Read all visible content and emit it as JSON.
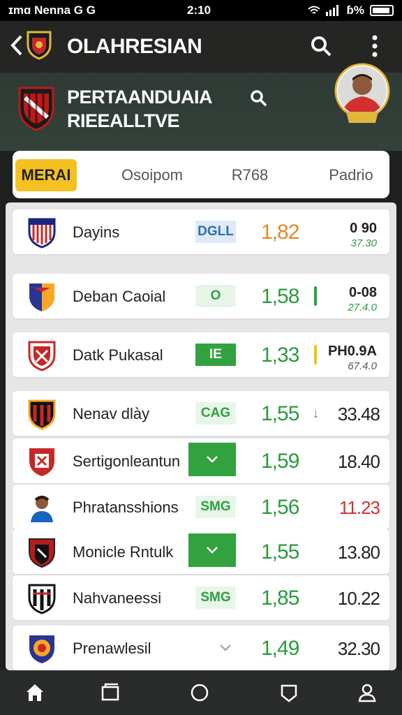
{
  "status_bar": {
    "left": "ɪmɑ Nenna  G  G",
    "time": "2:10",
    "right": "Ꞩ% ",
    "battery_label": "ɓ%"
  },
  "app_bar": {
    "title": "OLAHRESIAN",
    "back_icon": "chevron-left-icon",
    "search_icon": "search-icon",
    "menu_icon": "kebab-menu-icon"
  },
  "hero": {
    "title_line1": "PERTAANDUAIA",
    "title_line2": "RIEEALLTVE"
  },
  "tabs": [
    {
      "label": "MERAI",
      "active": true
    },
    {
      "label": "Osoipom",
      "active": false
    },
    {
      "label": "R768",
      "active": false
    },
    {
      "label": "Padrio",
      "active": false
    }
  ],
  "rows": [
    {
      "name": "Dayins",
      "badge": "DGLL",
      "badge_style": "blue",
      "odds": "1,82",
      "odds_color": "#e0872a",
      "right_top": "0 90",
      "right_sub": "37.30"
    },
    {
      "name": "Deban Caoial",
      "badge": "O",
      "badge_style": "lightgreen",
      "odds": "1,58",
      "indicator_color": "#2ea043",
      "right_top": "0-08",
      "right_sub": "27.4.0"
    },
    {
      "name": "Datk Pukasal",
      "badge": "IE",
      "badge_style": "green",
      "odds": "1,33",
      "indicator_color": "#f0c419",
      "right_top": "PH0.9A",
      "right_sub": "67.4.0"
    },
    {
      "name": "Nenav dlày",
      "badge": "CAG",
      "badge_style": "lightgreen",
      "odds": "1,55",
      "arrow": "↓",
      "right_main": "33.48",
      "right_main_color": "#222222"
    },
    {
      "name": "Sertigonleantun",
      "badge": "✓",
      "badge_style": "green-big",
      "odds": "1,59",
      "right_main": "18.40",
      "right_main_color": "#222222"
    },
    {
      "name": "Phratansshions",
      "badge": "SMG",
      "badge_style": "lightgreen",
      "odds": "1,56",
      "right_main": "11.23",
      "right_main_color": "#d32f2f"
    },
    {
      "name": "Monicle Rntulk",
      "badge": "✓",
      "badge_style": "green-big",
      "odds": "1,55",
      "right_main": "13.80",
      "right_main_color": "#222222"
    },
    {
      "name": "Nahvaneessi",
      "badge": "SMG",
      "badge_style": "lightgreen",
      "odds": "1,85",
      "right_main": "10.22",
      "right_main_color": "#222222"
    },
    {
      "name": "Prenawlesil",
      "badge": "✓",
      "badge_style": "chevron",
      "odds": "1,49",
      "right_main": "32.30",
      "right_main_color": "#222222"
    }
  ],
  "colors": {
    "accent": "#f5c122",
    "green": "#2c9a3e",
    "dark_bg": "#252523"
  },
  "bottom_nav": [
    "home-icon",
    "tabs-icon",
    "circle-icon",
    "bookmark-icon",
    "profile-icon"
  ]
}
